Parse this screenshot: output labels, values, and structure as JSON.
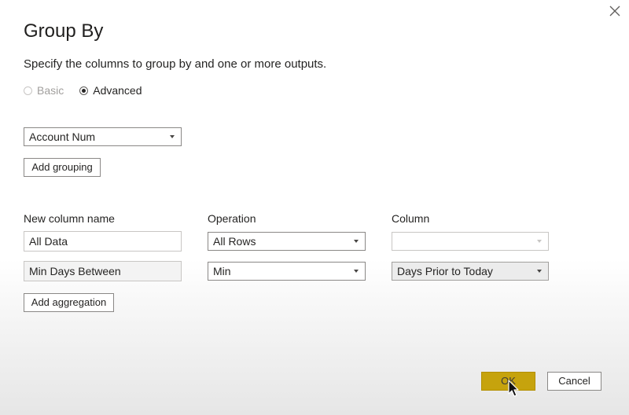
{
  "dialog": {
    "title": "Group By",
    "subtitle": "Specify the columns to group by and one or more outputs."
  },
  "mode": {
    "basic_label": "Basic",
    "advanced_label": "Advanced",
    "selected": "Advanced"
  },
  "grouping": {
    "columns": [
      "Account Num"
    ],
    "add_label": "Add grouping"
  },
  "aggregations": {
    "headers": {
      "name": "New column name",
      "operation": "Operation",
      "column": "Column"
    },
    "rows": [
      {
        "name": "All Data",
        "operation": "All Rows",
        "column": ""
      },
      {
        "name": "Min Days Between",
        "operation": "Min",
        "column": "Days Prior to Today"
      }
    ],
    "add_label": "Add aggregation"
  },
  "footer": {
    "ok_label": "OK",
    "cancel_label": "Cancel"
  },
  "colors": {
    "ok_button": "#c6a30d",
    "text": "#252423"
  },
  "icons": {
    "close": "close-icon",
    "dropdown": "chevron-down-icon",
    "cursor": "mouse-pointer-icon"
  }
}
